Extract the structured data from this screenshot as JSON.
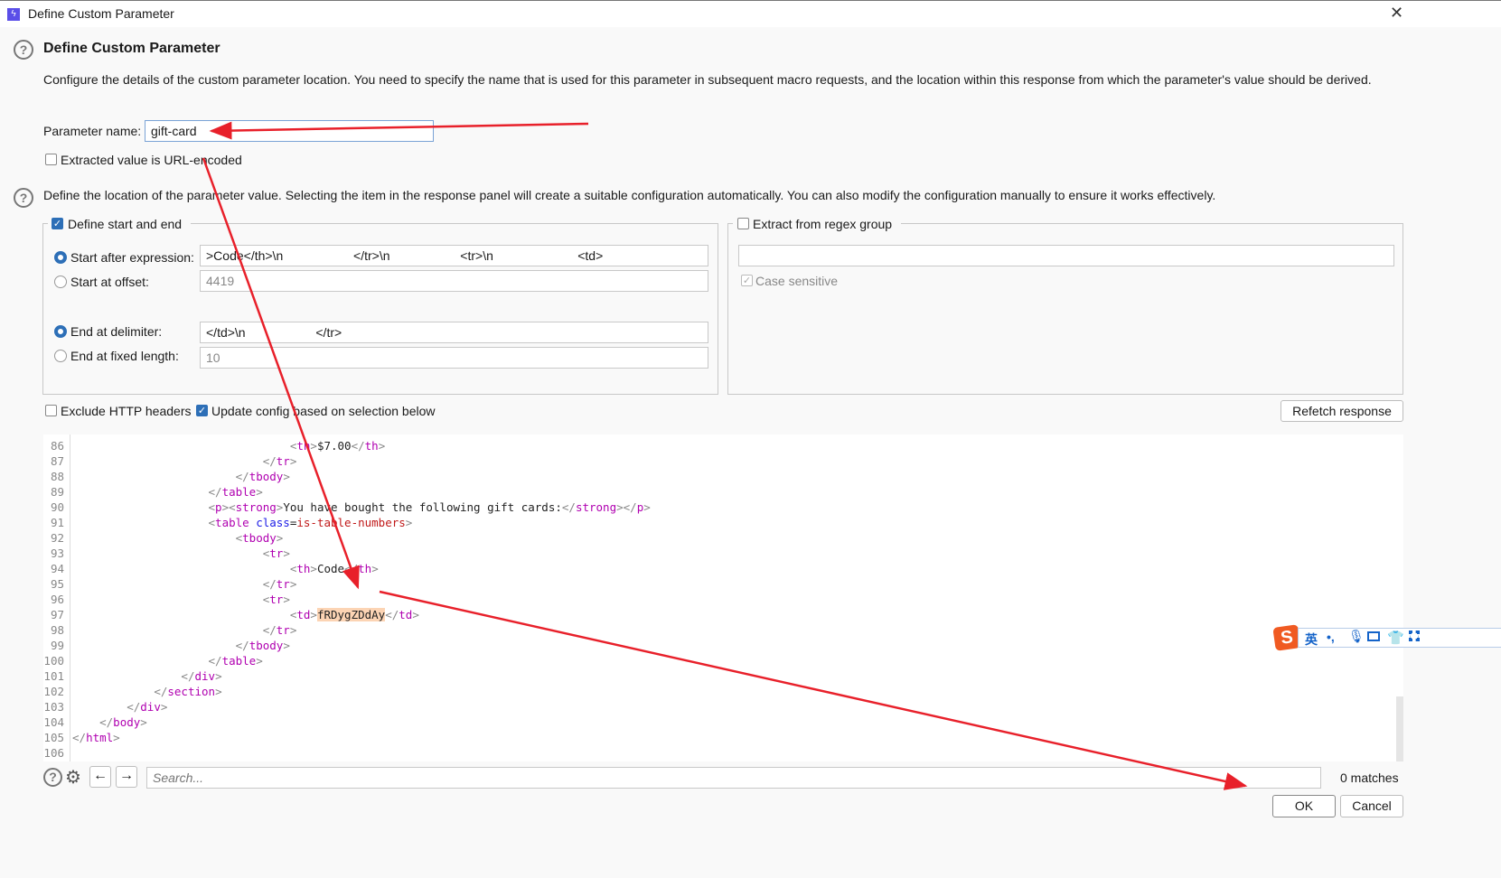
{
  "window": {
    "title": "Define Custom Parameter",
    "close_icon": "close-icon",
    "app_icon": "burp-icon"
  },
  "header": {
    "title": "Define Custom Parameter",
    "description": "Configure the details of the custom parameter location. You need to specify the name that is used for this parameter in subsequent macro requests, and the location within this response from which the parameter's value should be derived."
  },
  "param": {
    "label": "Parameter name:",
    "value": "gift-card"
  },
  "url_encoded": {
    "label": "Extracted value is URL-encoded",
    "checked": false
  },
  "location_desc": "Define the location of the parameter value. Selecting the item in the response panel will create a suitable configuration automatically. You can also modify the configuration manually to ensure it works effectively.",
  "start_end": {
    "label": "Define start and end",
    "checked": true,
    "start_after": {
      "label": "Start after expression:",
      "value": ">Code</th>\\n                    </tr>\\n                    <tr>\\n                        <td>",
      "selected": true
    },
    "start_offset": {
      "label": "Start at offset:",
      "value": "4419",
      "selected": false
    },
    "end_delim": {
      "label": "End at delimiter:",
      "value": "</td>\\n                    </tr>",
      "selected": true
    },
    "end_fixed": {
      "label": "End at fixed length:",
      "value": "10",
      "selected": false
    }
  },
  "regex": {
    "label": "Extract from regex group",
    "checked": false,
    "value": "",
    "case_label": "Case sensitive",
    "case_checked": true
  },
  "exclude_headers": {
    "label": "Exclude HTTP headers",
    "checked": false
  },
  "update_config": {
    "label": "Update config based on selection below",
    "checked": true
  },
  "refetch_label": "Refetch response",
  "code": {
    "lines": [
      {
        "n": "86",
        "indent": 32,
        "t": [
          [
            "<",
            "br"
          ],
          [
            "th",
            "tag"
          ],
          [
            ">",
            "br"
          ],
          [
            "$7.00",
            ""
          ],
          [
            "</",
            "br"
          ],
          [
            "th",
            "tag"
          ],
          [
            ">",
            "br"
          ]
        ]
      },
      {
        "n": "87",
        "indent": 28,
        "t": [
          [
            "</",
            "br"
          ],
          [
            "tr",
            "tag"
          ],
          [
            ">",
            "br"
          ]
        ]
      },
      {
        "n": "88",
        "indent": 24,
        "t": [
          [
            "</",
            "br"
          ],
          [
            "tbody",
            "tag"
          ],
          [
            ">",
            "br"
          ]
        ]
      },
      {
        "n": "89",
        "indent": 20,
        "t": [
          [
            "</",
            "br"
          ],
          [
            "table",
            "tag"
          ],
          [
            ">",
            "br"
          ]
        ]
      },
      {
        "n": "90",
        "indent": 20,
        "t": [
          [
            "<",
            "br"
          ],
          [
            "p",
            "tag"
          ],
          [
            ">",
            "br"
          ],
          [
            "<",
            "br"
          ],
          [
            "strong",
            "tag"
          ],
          [
            ">",
            "br"
          ],
          [
            "You have bought the following gift cards:",
            ""
          ],
          [
            "</",
            "br"
          ],
          [
            "strong",
            "tag"
          ],
          [
            ">",
            "br"
          ],
          [
            "</",
            "br"
          ],
          [
            "p",
            "tag"
          ],
          [
            ">",
            "br"
          ]
        ]
      },
      {
        "n": "91",
        "indent": 20,
        "t": [
          [
            "<",
            "br"
          ],
          [
            "table ",
            "tag"
          ],
          [
            "class",
            "attr"
          ],
          [
            "=",
            ""
          ],
          [
            "is-table-numbers",
            "val"
          ],
          [
            ">",
            "br"
          ]
        ]
      },
      {
        "n": "92",
        "indent": 24,
        "t": [
          [
            "<",
            "br"
          ],
          [
            "tbody",
            "tag"
          ],
          [
            ">",
            "br"
          ]
        ]
      },
      {
        "n": "93",
        "indent": 28,
        "t": [
          [
            "<",
            "br"
          ],
          [
            "tr",
            "tag"
          ],
          [
            ">",
            "br"
          ]
        ]
      },
      {
        "n": "94",
        "indent": 32,
        "t": [
          [
            "<",
            "br"
          ],
          [
            "th",
            "tag"
          ],
          [
            ">",
            "br"
          ],
          [
            "Code",
            ""
          ],
          [
            "</",
            "br"
          ],
          [
            "th",
            "tag"
          ],
          [
            ">",
            "br"
          ]
        ]
      },
      {
        "n": "95",
        "indent": 28,
        "t": [
          [
            "</",
            "br"
          ],
          [
            "tr",
            "tag"
          ],
          [
            ">",
            "br"
          ]
        ]
      },
      {
        "n": "96",
        "indent": 28,
        "t": [
          [
            "<",
            "br"
          ],
          [
            "tr",
            "tag"
          ],
          [
            ">",
            "br"
          ]
        ]
      },
      {
        "n": "97",
        "indent": 32,
        "t": [
          [
            "<",
            "br"
          ],
          [
            "td",
            "tag"
          ],
          [
            ">",
            "br"
          ],
          [
            "fRDygZDdAy",
            "hl"
          ],
          [
            "</",
            "br"
          ],
          [
            "td",
            "tag"
          ],
          [
            ">",
            "br"
          ]
        ]
      },
      {
        "n": "98",
        "indent": 28,
        "t": [
          [
            "</",
            "br"
          ],
          [
            "tr",
            "tag"
          ],
          [
            ">",
            "br"
          ]
        ]
      },
      {
        "n": "99",
        "indent": 24,
        "t": [
          [
            "</",
            "br"
          ],
          [
            "tbody",
            "tag"
          ],
          [
            ">",
            "br"
          ]
        ]
      },
      {
        "n": "100",
        "indent": 20,
        "t": [
          [
            "</",
            "br"
          ],
          [
            "table",
            "tag"
          ],
          [
            ">",
            "br"
          ]
        ]
      },
      {
        "n": "101",
        "indent": 16,
        "t": [
          [
            "</",
            "br"
          ],
          [
            "div",
            "tag"
          ],
          [
            ">",
            "br"
          ]
        ]
      },
      {
        "n": "102",
        "indent": 12,
        "t": [
          [
            "</",
            "br"
          ],
          [
            "section",
            "tag"
          ],
          [
            ">",
            "br"
          ]
        ]
      },
      {
        "n": "103",
        "indent": 8,
        "t": [
          [
            "</",
            "br"
          ],
          [
            "div",
            "tag"
          ],
          [
            ">",
            "br"
          ]
        ]
      },
      {
        "n": "104",
        "indent": 4,
        "t": [
          [
            "</",
            "br"
          ],
          [
            "body",
            "tag"
          ],
          [
            ">",
            "br"
          ]
        ]
      },
      {
        "n": "105",
        "indent": 0,
        "t": [
          [
            "</",
            "br"
          ],
          [
            "html",
            "tag"
          ],
          [
            ">",
            "br"
          ]
        ]
      },
      {
        "n": "106",
        "indent": 0,
        "t": []
      }
    ]
  },
  "search": {
    "placeholder": "Search...",
    "value": "",
    "matches": "0 matches"
  },
  "ime": {
    "lang": "英",
    "punct": "•,"
  },
  "footer": {
    "ok": "OK",
    "cancel": "Cancel"
  },
  "colors": {
    "accent": "#2d6fb7",
    "highlight": "#fcd4b4",
    "annotation": "#e8202a"
  }
}
